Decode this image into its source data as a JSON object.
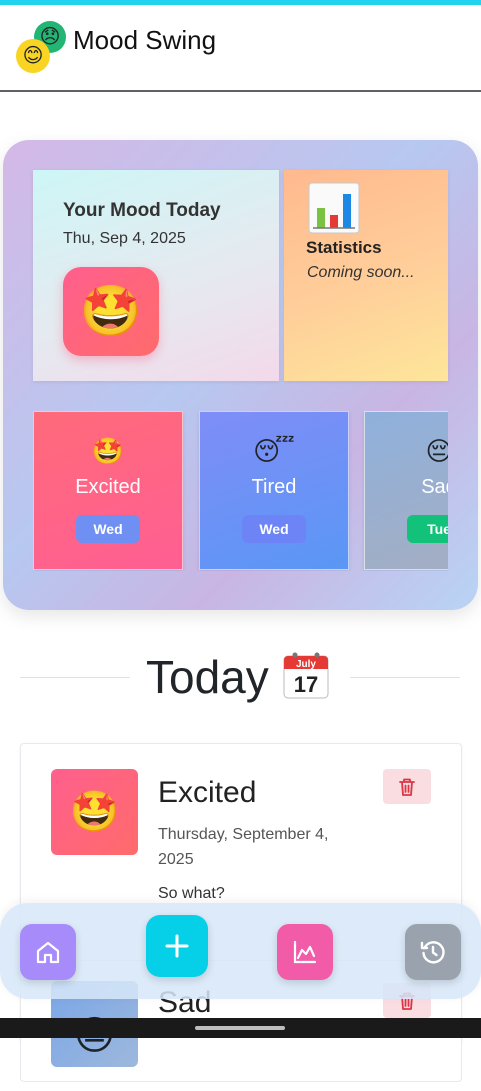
{
  "app": {
    "title": "Mood Swing"
  },
  "dashboard": {
    "mood_today": {
      "title": "Your Mood Today",
      "date": "Thu, Sep 4, 2025",
      "emoji": "🤩"
    },
    "statistics": {
      "title": "Statistics",
      "subtitle": "Coming soon..."
    },
    "recent": [
      {
        "emoji": "🤩",
        "label": "Excited",
        "day": "Wed"
      },
      {
        "emoji": "😴",
        "label": "Tired",
        "day": "Wed"
      },
      {
        "emoji": "😔",
        "label": "Sad",
        "day": "Tue"
      }
    ]
  },
  "today_section": {
    "title": "Today",
    "calendar_month": "July",
    "calendar_day": "17"
  },
  "entries": [
    {
      "emoji": "🤩",
      "mood": "Excited",
      "date": "Thursday, September 4, 2025",
      "note": "So what?"
    },
    {
      "emoji": "😔",
      "mood": "Sad"
    }
  ],
  "nav": {
    "items": [
      "home",
      "add",
      "chart",
      "history"
    ]
  },
  "colors": {
    "accent_cyan": "#22d3ee",
    "excited": "#ff5f8d",
    "tired": "#6e8ef7",
    "sad": "#9aa9c2",
    "nav_home": "#a78bfa",
    "nav_add": "#06d0e8",
    "nav_chart": "#f25ba8",
    "nav_history": "#9aa3ad"
  }
}
